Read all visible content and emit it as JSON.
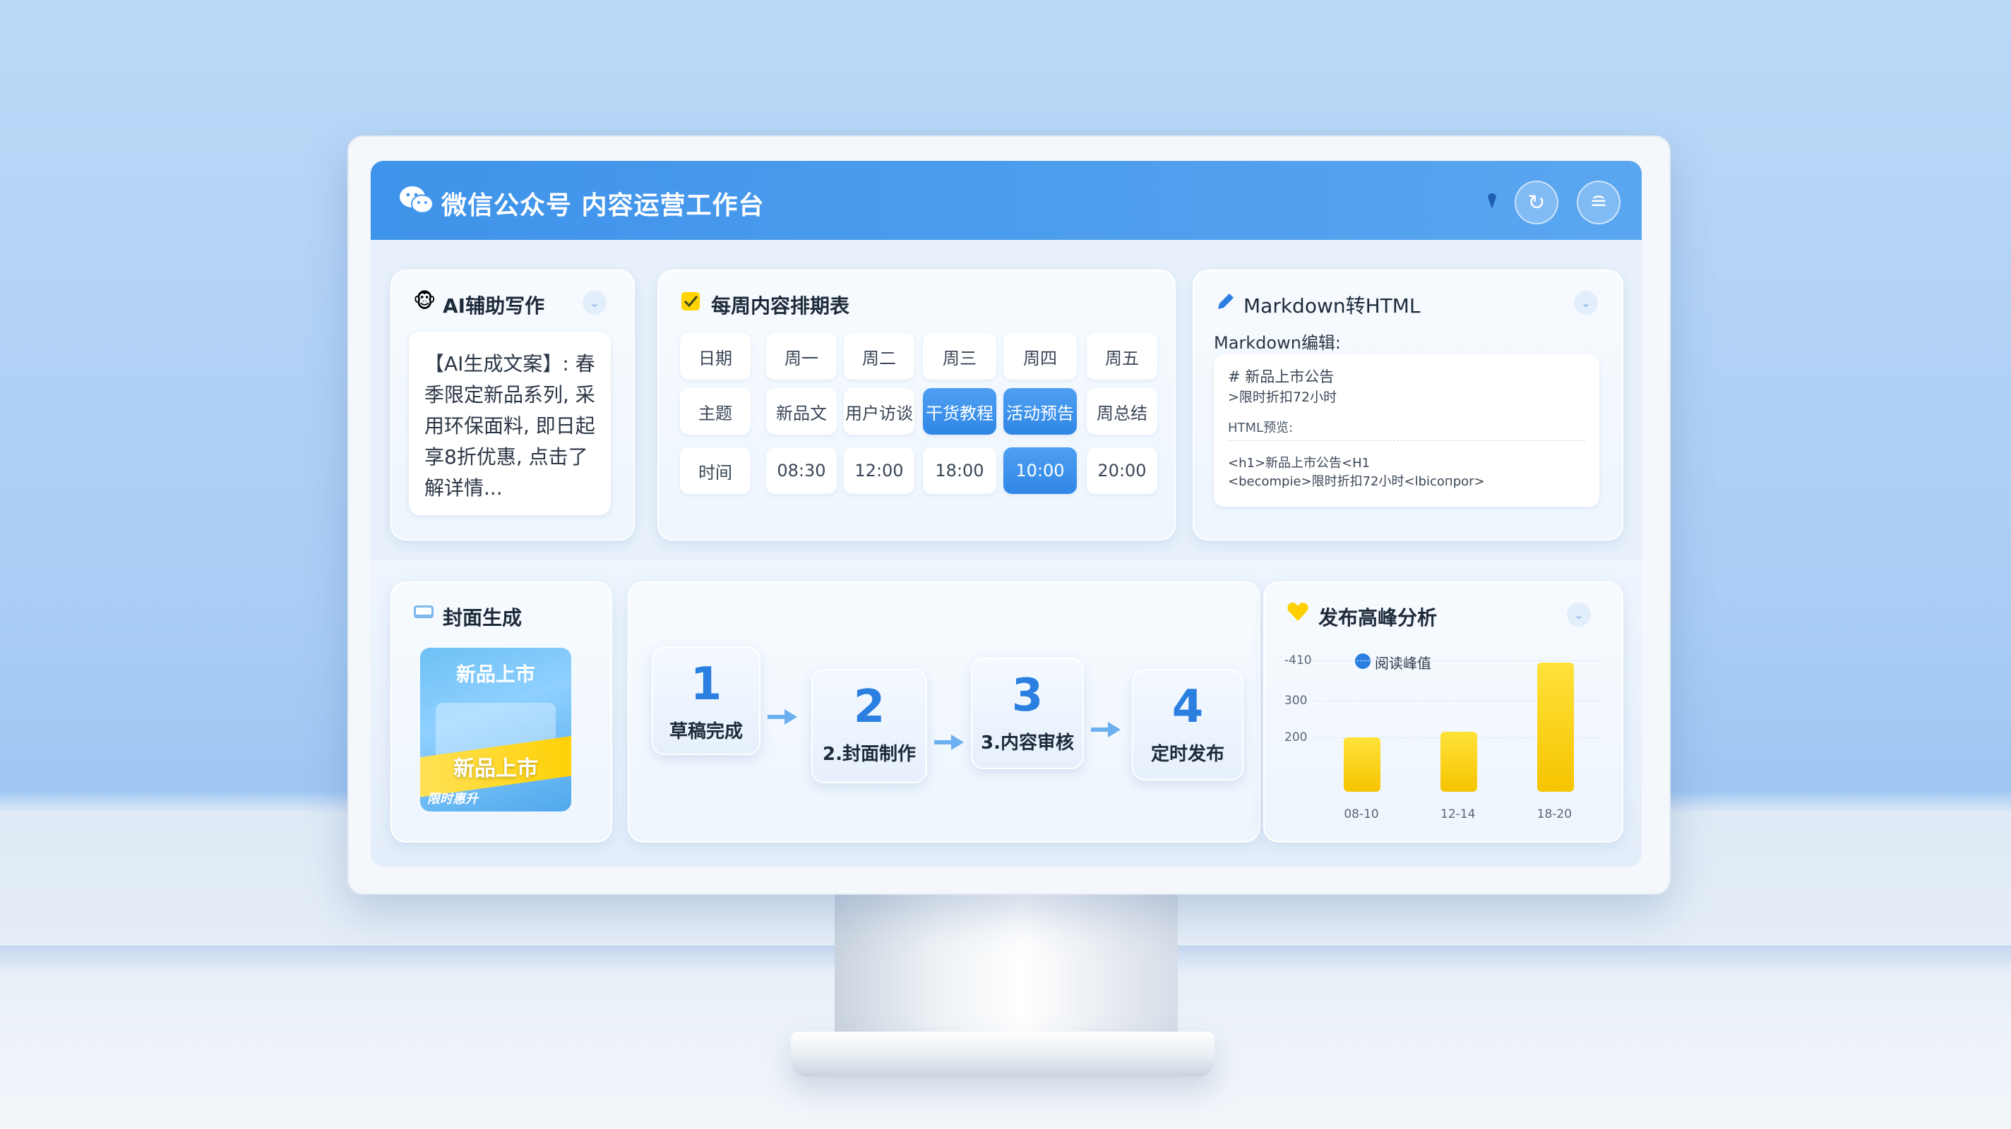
{
  "app": {
    "title": "微信公众号 内容运营工作台"
  },
  "ai_writing": {
    "title": "AI辅助写作",
    "content": "【AI生成文案】: 春季限定新品系列, 采用环保面料, 即日起享8折优惠, 点击了解详情..."
  },
  "schedule": {
    "title": "每周内容排期表",
    "header": [
      "日期",
      "周一",
      "周二",
      "周三",
      "周四",
      "周五"
    ],
    "rows": [
      {
        "label": "主题",
        "cells": [
          "新品文",
          "用户访谈",
          "干货教程",
          "活动预告",
          "周总结"
        ],
        "highlight": [
          2,
          3
        ]
      },
      {
        "label": "时间",
        "cells": [
          "08:30",
          "12:00",
          "18:00",
          "10:00",
          "20:00"
        ],
        "highlight": [
          3
        ]
      }
    ]
  },
  "markdown": {
    "title": "Markdown转HTML",
    "edit_label": "Markdown编辑:",
    "md_line1": "#   新品上市公告",
    "md_line2": ">限时折扣72小时",
    "preview_label": "HTML预览:",
    "html_line1": "<h1>新品上市公告<H1",
    "html_line2": "<becompie>限时折扣72小时<lbicoпpor>"
  },
  "cover": {
    "title": "封面生成",
    "text_top": "新品上市",
    "text_mid": "新品上市",
    "text_bottom": "限时惠升"
  },
  "workflow": {
    "steps": [
      {
        "num": "1",
        "label": "草稿完成"
      },
      {
        "num": "2",
        "label": "2.封面制作"
      },
      {
        "num": "3",
        "label": "3.内容审核"
      },
      {
        "num": "4",
        "label": "定时发布"
      }
    ]
  },
  "chart_data": {
    "type": "bar",
    "title": "发布高峰分析",
    "legend": [
      "阅读峰值"
    ],
    "legend_position": "top-left",
    "categories": [
      "08-10",
      "12-14",
      "18-20"
    ],
    "series": [
      {
        "name": "阅读峰值",
        "values": [
          200,
          215,
          405
        ]
      }
    ],
    "y_ticks": [
      "-410",
      "300",
      "200"
    ],
    "y_tick_values": [
      410,
      300,
      200
    ],
    "ylim": [
      50,
      430
    ],
    "colors": {
      "bar": "#f6c400",
      "legend_dot": "#2a7fe0"
    }
  }
}
